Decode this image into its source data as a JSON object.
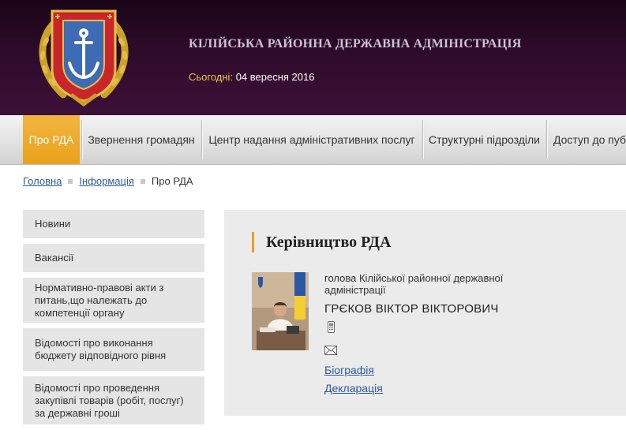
{
  "header": {
    "title": "КІЛІЙСЬКА РАЙОННА ДЕРЖАВНА АДМІНІСТРАЦІЯ",
    "today_label": "Сьогодні:",
    "today_value": "04 вересня 2016"
  },
  "nav": {
    "items": [
      {
        "label": "Про РДА",
        "active": true
      },
      {
        "label": "Звернення громадян"
      },
      {
        "label": "Центр надання адміністративних послуг"
      },
      {
        "label": "Структурні підрозділи"
      },
      {
        "label": "Доступ до пуб"
      }
    ]
  },
  "breadcrumb": {
    "items": [
      "Головна",
      "Інформація",
      "Про РДА"
    ]
  },
  "sidebar": {
    "items": [
      {
        "label": "Новини"
      },
      {
        "label": "Вакансії"
      },
      {
        "label": "Нормативно-правові акти з питань,що належать до компетенції органу"
      },
      {
        "label": "Відомості про виконання бюджету відповідного рівня"
      },
      {
        "label": "Відомості про проведення закупівлі товарів (робіт, послуг) за державні гроші"
      }
    ]
  },
  "main": {
    "title": "Керівництво РДА",
    "person": {
      "position": "голова Кілійської районної державної адміністрації",
      "name": "ГРЄКОВ ВІКТОР ВІКТОРОВИЧ",
      "links": [
        "Біографія",
        "Декларація"
      ]
    }
  },
  "colors": {
    "header_bg": "#2e0b2a",
    "accent": "#e9a11b",
    "link": "#2c5aa0",
    "today_label": "#f2c24d"
  },
  "icons": [
    "emblem-icon",
    "phone-icon",
    "mail-icon"
  ]
}
